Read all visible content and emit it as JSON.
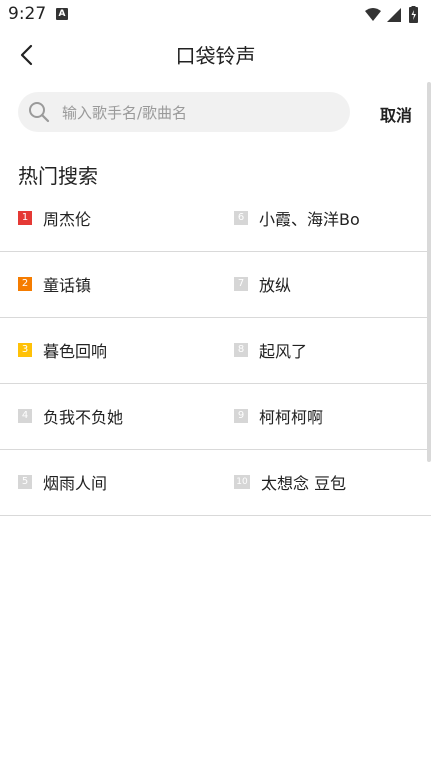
{
  "status_bar": {
    "time": "9:27",
    "notification_badge": "A",
    "icons": [
      "wifi-icon",
      "signal-icon",
      "battery-icon"
    ]
  },
  "header": {
    "title": "口袋铃声",
    "back_icon": "chevron-left-icon"
  },
  "search": {
    "placeholder": "输入歌手名/歌曲名",
    "value": "",
    "cancel_label": "取消"
  },
  "hot_search": {
    "title": "热门搜索",
    "left_items": [
      {
        "rank": "1",
        "label": "周杰伦",
        "color": "#e53935"
      },
      {
        "rank": "2",
        "label": "童话镇",
        "color": "#f57c00"
      },
      {
        "rank": "3",
        "label": "暮色回响",
        "color": "#ffc107"
      },
      {
        "rank": "4",
        "label": "负我不负她",
        "color": "#d6d6d6"
      },
      {
        "rank": "5",
        "label": "烟雨人间",
        "color": "#d6d6d6"
      }
    ],
    "right_items": [
      {
        "rank": "6",
        "label": "小霞、海洋Bo",
        "color": "#d6d6d6"
      },
      {
        "rank": "7",
        "label": "放纵",
        "color": "#d6d6d6"
      },
      {
        "rank": "8",
        "label": "起风了",
        "color": "#d6d6d6"
      },
      {
        "rank": "9",
        "label": "柯柯柯啊",
        "color": "#d6d6d6"
      },
      {
        "rank": "10",
        "label": "太想念 豆包",
        "color": "#d6d6d6"
      }
    ]
  }
}
